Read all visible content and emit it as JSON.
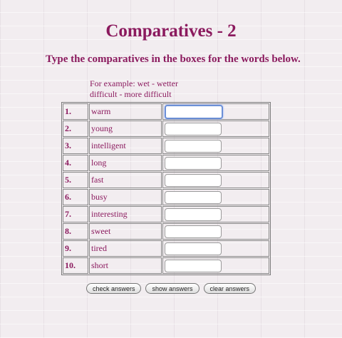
{
  "title": "Comparatives - 2",
  "instructions": "Type the comparatives in the boxes for the words below.",
  "example": {
    "line1": "For example: wet - wetter",
    "line2": "difficult - more difficult"
  },
  "questions": [
    {
      "num": "1.",
      "word": "warm",
      "answer": ""
    },
    {
      "num": "2.",
      "word": "young",
      "answer": ""
    },
    {
      "num": "3.",
      "word": "intelligent",
      "answer": ""
    },
    {
      "num": "4.",
      "word": "long",
      "answer": ""
    },
    {
      "num": "5.",
      "word": "fast",
      "answer": ""
    },
    {
      "num": "6.",
      "word": "busy",
      "answer": ""
    },
    {
      "num": "7.",
      "word": "interesting",
      "answer": ""
    },
    {
      "num": "8.",
      "word": "sweet",
      "answer": ""
    },
    {
      "num": "9.",
      "word": "tired",
      "answer": ""
    },
    {
      "num": "10.",
      "word": "short",
      "answer": ""
    }
  ],
  "buttons": {
    "check": "check answers",
    "show": "show answers",
    "clear": "clear answers"
  },
  "colors": {
    "heading": "#8b1a5e",
    "background": "#f2edf0",
    "focus_ring": "#6b8fd6"
  }
}
